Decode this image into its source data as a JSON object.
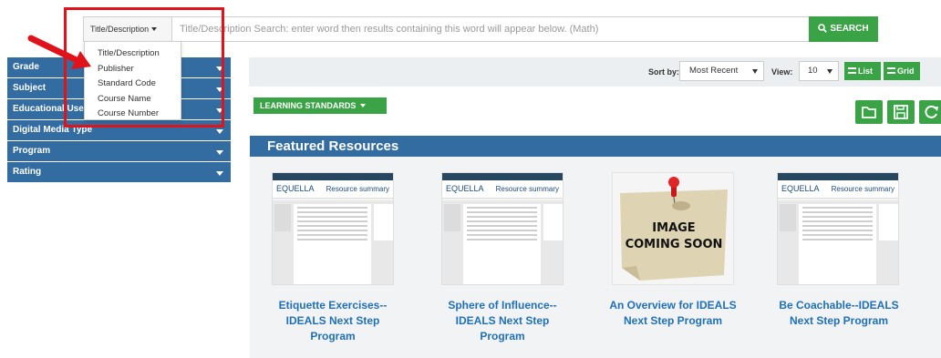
{
  "search": {
    "type_selected": "Title/Description",
    "placeholder": "Title/Description Search:  enter word then results containing this word will appear below. (Math)",
    "button_label": "SEARCH"
  },
  "search_type_options": [
    "Title/Description",
    "Publisher",
    "Standard Code",
    "Course Name",
    "Course Number"
  ],
  "sidebar": {
    "facets": [
      "Grade",
      "Subject",
      "Educational Use",
      "Digital Media Type",
      "Program",
      "Rating"
    ]
  },
  "toolbar": {
    "sort_label": "Sort by:",
    "sort_value": "Most Recent",
    "view_label": "View:",
    "view_value": "10",
    "list_label": "List",
    "grid_label": "Grid"
  },
  "learning_standards_label": "LEARNING STANDARDS",
  "featured": {
    "heading": "Featured Resources",
    "cards": [
      {
        "title": "Etiquette Exercises--IDEALS Next Step Program",
        "line1": "Etiquette Exercises--",
        "line2": "IDEALS Next Step",
        "line3": "Program",
        "thumb_logo": "EQUELLA",
        "thumb_tab": "Resource summary"
      },
      {
        "title": "Sphere of Influence--IDEALS Next Step Program",
        "line1": "Sphere of Influence--",
        "line2": "IDEALS Next Step",
        "line3": "Program",
        "thumb_logo": "EQUELLA",
        "thumb_tab": "Resource summary"
      },
      {
        "title": "An Overview for IDEALS Next Step Program",
        "line1": "An Overview for IDEALS",
        "line2": "Next Step Program",
        "line3": "",
        "thumb_text_1": "IMAGE",
        "thumb_text_2": "COMING SOON"
      },
      {
        "title": "Be Coachable--IDEALS Next Step Program",
        "line1": "Be Coachable--IDEALS",
        "line2": "Next Step Program",
        "line3": "",
        "thumb_logo": "EQUELLA",
        "thumb_tab": "Resource summary"
      }
    ]
  },
  "colors": {
    "facet_blue": "#336ca1",
    "green": "#3aa345",
    "highlight_red": "#e0121a",
    "link_blue": "#1f70b8"
  }
}
